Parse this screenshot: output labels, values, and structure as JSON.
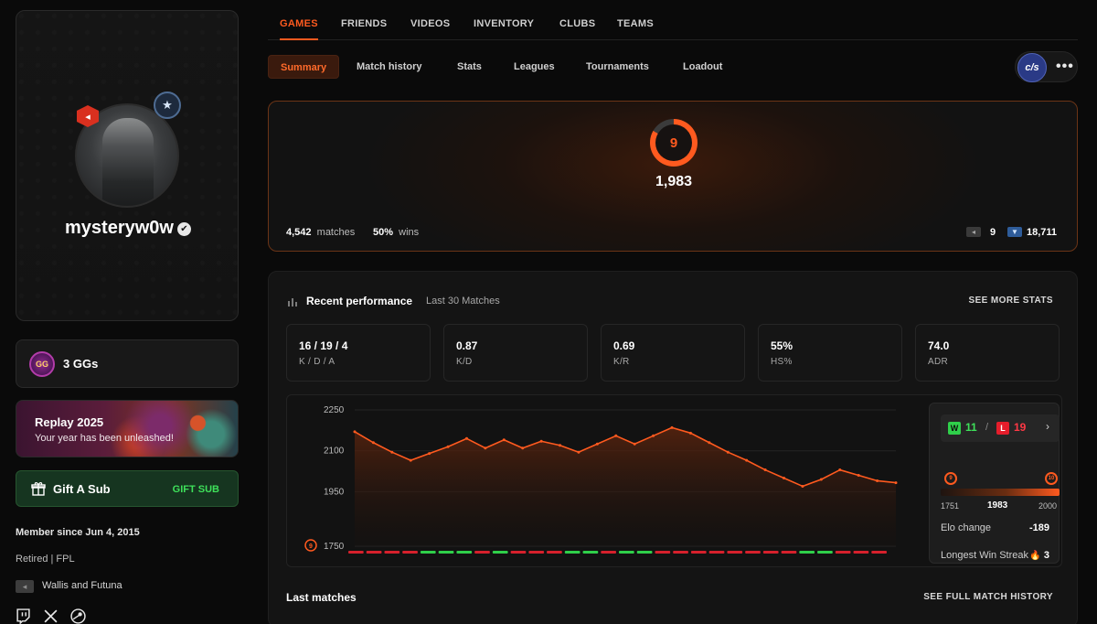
{
  "profile": {
    "username": "mysteryw0w",
    "level_badge": "◂",
    "rank_badge": "★",
    "gg_count": "3 GGs",
    "gg_icon_text": "GG",
    "replay_title": "Replay 2025",
    "replay_subtitle": "Your year has been unleashed!",
    "gift_label": "Gift A Sub",
    "gift_cta": "GIFT SUB",
    "member_since": "Member since Jun 4, 2015",
    "status": "Retired | FPL",
    "country": "Wallis and Futuna",
    "flag_icon": "◂"
  },
  "top_nav": [
    "GAMES",
    "FRIENDS",
    "VIDEOS",
    "INVENTORY",
    "CLUBS",
    "TEAMS"
  ],
  "sub_nav": [
    "Summary",
    "Match history",
    "Stats",
    "Leagues",
    "Tournaments",
    "Loadout"
  ],
  "org": {
    "logo_text": "c/s",
    "more": "•••"
  },
  "elo_card": {
    "level": "9",
    "elo": "1,983",
    "matches_value": "4,542",
    "matches_label": "matches",
    "wins_value": "50%",
    "wins_label": "wins",
    "chip_one_icon": "◂",
    "chip_one_value": "9",
    "chip_two_icon": "▼",
    "chip_two_value": "18,711"
  },
  "performance": {
    "title": "Recent performance",
    "subtitle": "Last 30 Matches",
    "see_more": "SEE MORE STATS",
    "stats": [
      {
        "value": "16 / 19 / 4",
        "label": "K / D / A"
      },
      {
        "value": "0.87",
        "label": "K/D"
      },
      {
        "value": "0.69",
        "label": "K/R"
      },
      {
        "value": "55%",
        "label": "HS%"
      },
      {
        "value": "74.0",
        "label": "ADR"
      }
    ],
    "side": {
      "w_label": "W",
      "wins": "11",
      "slash": "/",
      "l_label": "L",
      "losses": "19",
      "chevron": "›",
      "level_left": "9",
      "level_right": "10",
      "range_min": "1751",
      "range_current": "1983",
      "range_max": "2000",
      "elo_change_label": "Elo change",
      "elo_change_value": "-189",
      "win_streak_label": "Longest Win Streak",
      "win_streak_icon": "🔥",
      "win_streak_value": "3"
    },
    "last_matches": "Last matches",
    "see_full": "SEE FULL MATCH HISTORY"
  },
  "chart_data": {
    "type": "area",
    "ylim": [
      1750,
      2250
    ],
    "yticks": [
      "2250",
      "2100",
      "1950",
      "1750"
    ],
    "level_marker": "9",
    "x": [
      1,
      2,
      3,
      4,
      5,
      6,
      7,
      8,
      9,
      10,
      11,
      12,
      13,
      14,
      15,
      16,
      17,
      18,
      19,
      20,
      21,
      22,
      23,
      24,
      25,
      26,
      27,
      28,
      29,
      30
    ],
    "values": [
      2170,
      2130,
      2095,
      2065,
      2090,
      2115,
      2145,
      2110,
      2140,
      2110,
      2135,
      2120,
      2095,
      2125,
      2155,
      2125,
      2155,
      2185,
      2165,
      2130,
      2095,
      2065,
      2030,
      2000,
      1970,
      1995,
      2030,
      2010,
      1990,
      1983
    ],
    "results": [
      "L",
      "L",
      "L",
      "L",
      "W",
      "W",
      "W",
      "L",
      "W",
      "L",
      "L",
      "L",
      "W",
      "W",
      "L",
      "W",
      "W",
      "L",
      "L",
      "L",
      "L",
      "L",
      "L",
      "L",
      "L",
      "W",
      "W",
      "L",
      "L",
      "L"
    ],
    "colors": {
      "line": "#ff5a1f",
      "win": "#2fcf4a",
      "loss": "#d6202c"
    }
  },
  "colors": {
    "accent": "#ff5a1f",
    "win": "#3ee05a",
    "loss": "#ff3845",
    "gift_bg": "#163520"
  }
}
